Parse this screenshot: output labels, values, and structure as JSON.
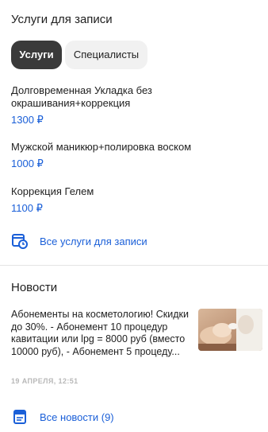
{
  "services_section": {
    "title": "Услуги для записи",
    "tabs": [
      {
        "label": "Услуги",
        "active": true
      },
      {
        "label": "Специалисты",
        "active": false
      }
    ],
    "items": [
      {
        "name": "Долговременная Укладка без окрашивания+коррекция",
        "price": "1300 ₽"
      },
      {
        "name": "Мужской маникюр+полировка воском",
        "price": "1000 ₽"
      },
      {
        "name": "Коррекция Гелем",
        "price": "1100 ₽"
      }
    ],
    "all_link": {
      "label": "Все услуги для записи",
      "icon": "calendar-clock-icon"
    }
  },
  "news_section": {
    "title": "Новости",
    "item": {
      "text": "Абонементы на косметологию! Скидки до 30%. - Абонемент 10 процедур кавитации или lpg = 8000 руб (вместо 10000 руб), - Абонемент 5 процеду...",
      "date": "19 АПРЕЛЯ, 12:51"
    },
    "all_link": {
      "label": "Все новости (9)",
      "icon": "news-calendar-icon"
    }
  },
  "colors": {
    "accent": "#1a5fd8",
    "active_tab": "#3a3a3a",
    "inactive_tab": "#f1f1f1"
  }
}
